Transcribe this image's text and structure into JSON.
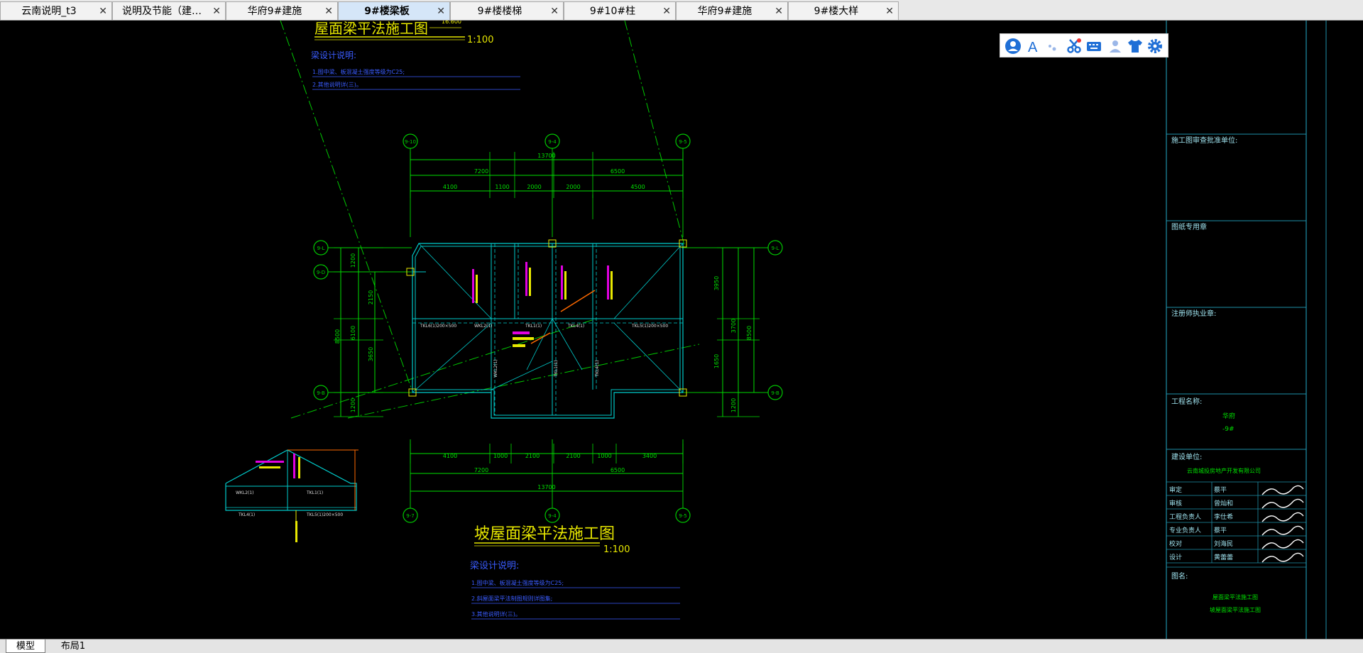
{
  "tabs": [
    {
      "label": "云南说明_t3",
      "close": "✕"
    },
    {
      "label": "说明及节能（建…",
      "close": "✕"
    },
    {
      "label": "华府9#建施",
      "close": "✕"
    },
    {
      "label": "9#楼梁板",
      "close": "✕"
    },
    {
      "label": "9#楼楼梯",
      "close": "✕"
    },
    {
      "label": "9#10#柱",
      "close": "✕"
    },
    {
      "label": "华府9#建施",
      "close": "✕"
    },
    {
      "label": "9#楼大样",
      "close": "✕"
    }
  ],
  "active_tab_index": 3,
  "floating_toolbar": {
    "icons": [
      "user-icon",
      "font-icon",
      "dot-icon",
      "scissors-icon",
      "keyboard-icon",
      "person-icon",
      "shirt-icon",
      "gear-icon"
    ],
    "font_glyph": "A"
  },
  "drawing": {
    "top_title": "屋面梁平法施工图",
    "top_scale": "1:100",
    "top_level": "16.600",
    "top_notes_title": "梁设计说明:",
    "top_notes": [
      "1.图中梁、板混凝土强度等级为C25;",
      "2.其他说明详(三)。"
    ],
    "axes_top": [
      "9-10",
      "9-4",
      "9-5"
    ],
    "axes_bottom": [
      "9-7",
      "9-4",
      "9-5"
    ],
    "axes_left": [
      "9-L",
      "9-D",
      "9-B"
    ],
    "axes_right": [
      "9-L",
      "9-B"
    ],
    "dims_top_total": "13700",
    "dims_top_mid": [
      "7200",
      "6500"
    ],
    "dims_top_detail": [
      "4100",
      "1100",
      "2000",
      "2000",
      "4500"
    ],
    "dims_bottom_detail": [
      "4100",
      "1000",
      "2100",
      "2100",
      "1000",
      "3400"
    ],
    "dims_bottom_mid": [
      "7200",
      "6500"
    ],
    "dims_bottom_total": "13700",
    "dims_left": [
      "1200",
      "2150",
      "6100",
      "3650",
      "1200",
      "8500"
    ],
    "dims_right": [
      "3950",
      "3700",
      "1650",
      "8500",
      "1200"
    ],
    "beam_labels": [
      "TKL6(1)200×500",
      "WKL2(1)",
      "TKL1(1)",
      "TKL4(1)",
      "TKL5(1)200×500"
    ],
    "main_title": "坡屋面梁平法施工图",
    "main_scale": "1:100",
    "bottom_notes_title": "梁设计说明:",
    "bottom_notes": [
      "1.图中梁、板混凝土强度等级为C25;",
      "2.斜屋面梁平法制图规则详图集;",
      "3.其他说明详(三)。"
    ]
  },
  "title_block": {
    "review_unit": "施工图审查批准单位:",
    "drawing_seal": "图纸专用章",
    "registered": "注册师执业章:",
    "project_name_label": "工程名称:",
    "project_name": "华府",
    "project_sub": "-9#",
    "client_label": "建设单位:",
    "client": "云南城投房地产开发有限公司",
    "roles": [
      {
        "role": "审定",
        "name": "蔡平"
      },
      {
        "role": "审核",
        "name": "曾灿和"
      },
      {
        "role": "工程负责人",
        "name": "李仕希"
      },
      {
        "role": "专业负责人",
        "name": "蔡平"
      },
      {
        "role": "校对",
        "name": "刘海民"
      },
      {
        "role": "设计",
        "name": "黄蕾蕾"
      }
    ],
    "drawing_name_label": "图名:",
    "drawing_names": [
      "屋面梁平法施工图",
      "坡屋面梁平法施工图"
    ]
  },
  "bottom_tabs": [
    "模型",
    "布局1"
  ],
  "colors": {
    "axis": "#00c800",
    "beam": "#00cccc",
    "dim": "#00e000",
    "title": "#e6e600",
    "note": "#3a5cff",
    "label_magenta": "#e000e0",
    "label_yellow": "#e8e800",
    "frame": "#1e8fa8"
  }
}
